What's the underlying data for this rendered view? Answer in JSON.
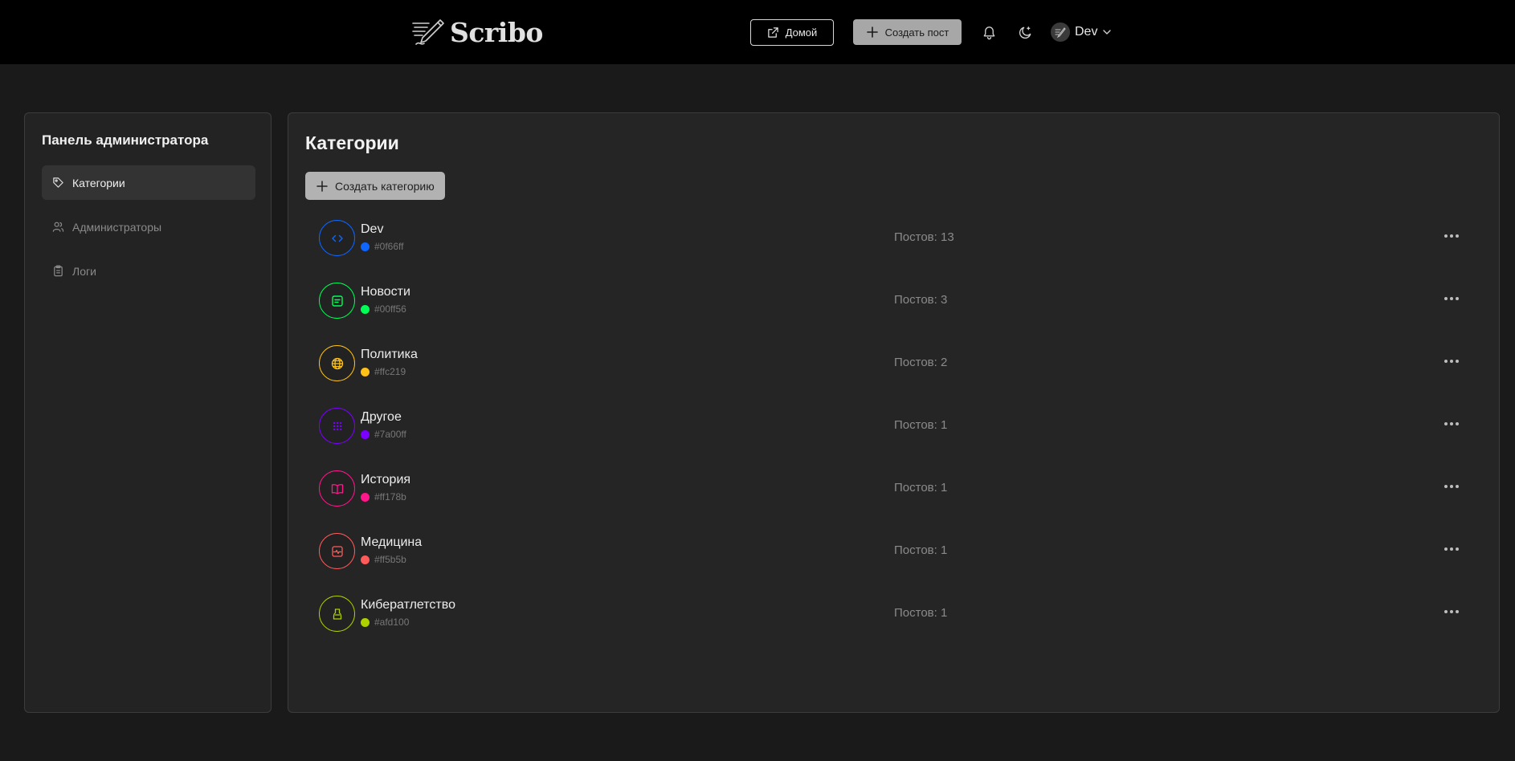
{
  "header": {
    "logo_text": "Scribo",
    "home_label": "Домой",
    "create_post_label": "Создать пост",
    "user_name": "Dev"
  },
  "sidebar": {
    "title": "Панель администратора",
    "items": [
      {
        "label": "Категории",
        "icon": "tag-icon",
        "active": true
      },
      {
        "label": "Администраторы",
        "icon": "users-icon",
        "active": false
      },
      {
        "label": "Логи",
        "icon": "clipboard-icon",
        "active": false
      }
    ]
  },
  "main": {
    "title": "Категории",
    "create_label": "Создать категорию",
    "categories": [
      {
        "name": "Dev",
        "hex": "#0f66ff",
        "color": "#0f66ff",
        "icon": "code-icon",
        "posts": "Постов: 13"
      },
      {
        "name": "Новости",
        "hex": "#00ff56",
        "color": "#00ff56",
        "icon": "news-icon",
        "posts": "Постов: 3"
      },
      {
        "name": "Политика",
        "hex": "#ffc219",
        "color": "#ffc219",
        "icon": "globe-icon",
        "posts": "Постов: 2"
      },
      {
        "name": "Другое",
        "hex": "#7a00ff",
        "color": "#7a00ff",
        "icon": "grid-dots-icon",
        "posts": "Постов: 1"
      },
      {
        "name": "История",
        "hex": "#ff178b",
        "color": "#ff178b",
        "icon": "book-icon",
        "posts": "Постов: 1"
      },
      {
        "name": "Медицина",
        "hex": "#ff5b5b",
        "color": "#ff5b5b",
        "icon": "heart-monitor-icon",
        "posts": "Постов: 1"
      },
      {
        "name": "Кибератлетство",
        "hex": "#afd100",
        "color": "#afd100",
        "icon": "gamepad-icon",
        "posts": "Постов: 1"
      }
    ]
  }
}
